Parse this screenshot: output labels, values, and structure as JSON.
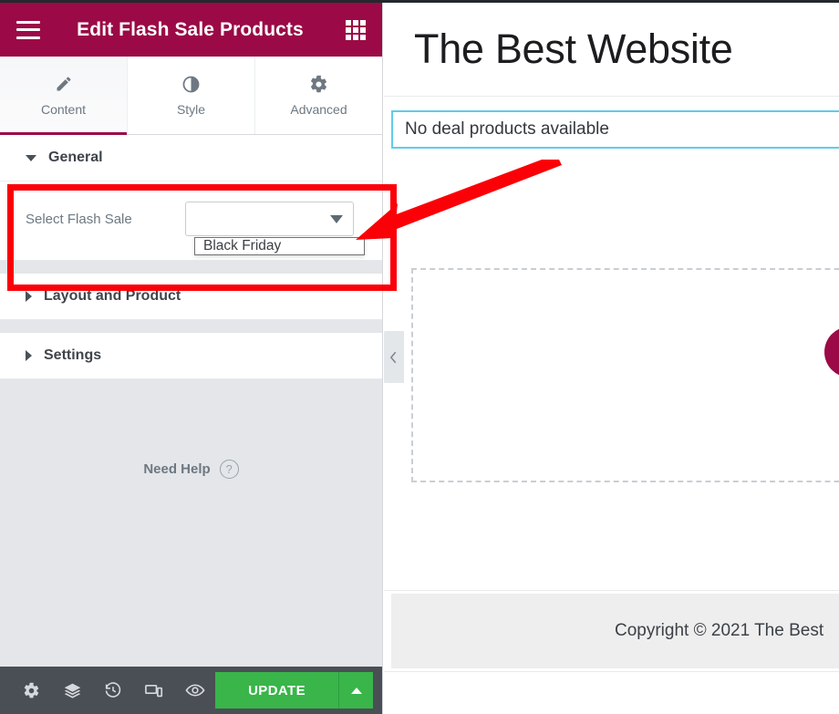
{
  "editor": {
    "header": {
      "title": "Edit Flash Sale Products",
      "menu_icon": "hamburger-icon",
      "apps_icon": "grid-apps-icon",
      "brand_color": "#9b0a46"
    },
    "tabs": [
      {
        "label": "Content",
        "icon": "pencil-icon",
        "active": true
      },
      {
        "label": "Style",
        "icon": "contrast-icon",
        "active": false
      },
      {
        "label": "Advanced",
        "icon": "gear-icon",
        "active": false
      }
    ],
    "sections": [
      {
        "label": "General",
        "expanded": true
      },
      {
        "label": "Layout and Product",
        "expanded": false
      },
      {
        "label": "Settings",
        "expanded": false
      }
    ],
    "general": {
      "field_label": "Select Flash Sale",
      "select_value": "",
      "select_placeholder": "",
      "dropdown_open": true,
      "options": [
        "Black Friday"
      ]
    },
    "need_help": {
      "label": "Need Help",
      "icon_glyph": "?"
    },
    "footer": {
      "icons": [
        {
          "name": "settings-gear-icon"
        },
        {
          "name": "navigator-layers-icon"
        },
        {
          "name": "history-clock-icon"
        },
        {
          "name": "responsive-devices-icon"
        },
        {
          "name": "preview-eye-icon"
        }
      ],
      "update_label": "UPDATE",
      "update_color": "#39b54a",
      "caret_icon": "caret-up-icon"
    }
  },
  "preview": {
    "site_title": "The Best Website",
    "notice": "No deal products available",
    "notice_border_color": "#61cbea",
    "collapse_icon": "chevron-left-icon",
    "copyright": "Copyright © 2021 The Best",
    "accent_dot_color": "#9b0a46"
  },
  "annotation": {
    "highlight_color": "#fb0007",
    "box_target": "select-flash-sale-control",
    "arrow_points_to": "select-dropdown-caret"
  }
}
